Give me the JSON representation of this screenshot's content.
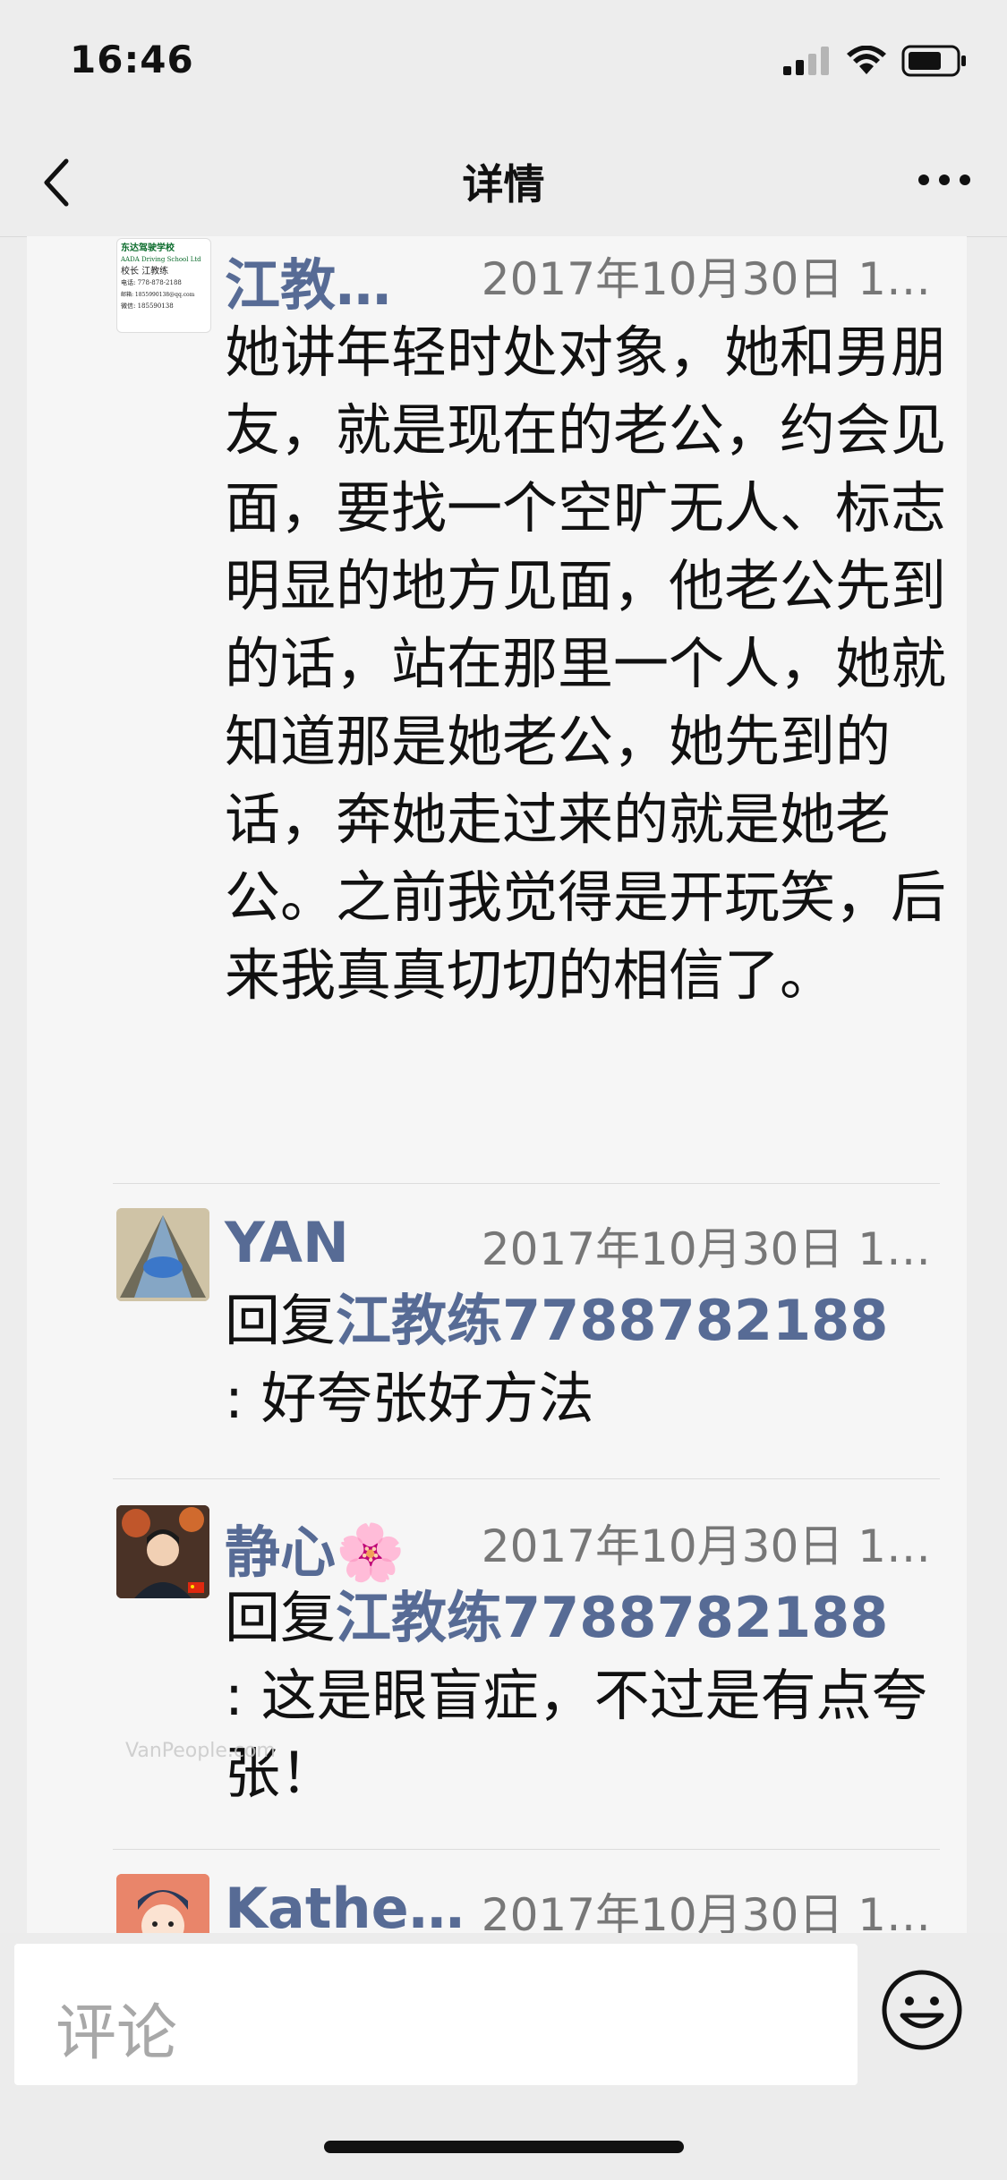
{
  "status_bar": {
    "time": "16:46"
  },
  "nav": {
    "title": "详情"
  },
  "comments": [
    {
      "name": "江教…",
      "time": "2017年10月30日 1…",
      "text": "她讲年轻时处对象，她和男朋友，就是现在的老公，约会见面，要找一个空旷无人、标志明显的地方见面，他老公先到的话，站在那里一个人，她就知道那是她老公，她先到的话，奔她走过来的就是她老公。之前我觉得是开玩笑，后来我真真切切的相信了。",
      "avatar_text": {
        "school": "东达驾驶学校",
        "school_en": "AADA Driving School Ltd",
        "role": "校长",
        "person": "江教练",
        "phone": "电话: 778-878-2188",
        "email": "邮箱: 1855990138@qq.com",
        "wechat": "微信: 185590138"
      }
    },
    {
      "name": "YAN",
      "time": "2017年10月30日 1…",
      "reply_prefix": "回复",
      "reply_to": "江教练7788782188",
      "text": ": 好夸张好方法"
    },
    {
      "name": "静心🌸",
      "time": "2017年10月30日 1…",
      "reply_prefix": "回复",
      "reply_to": "江教练7788782188",
      "text": ": 这是眼盲症，不过是有点夸张！"
    },
    {
      "name": "Kathe…",
      "time": "2017年10月30日 1…"
    }
  ],
  "comment_bar": {
    "placeholder": "评论"
  },
  "watermark": "VanPeople.com",
  "colors": {
    "link": "#576b95",
    "background": "#ededed",
    "panel": "#f6f6f6"
  }
}
